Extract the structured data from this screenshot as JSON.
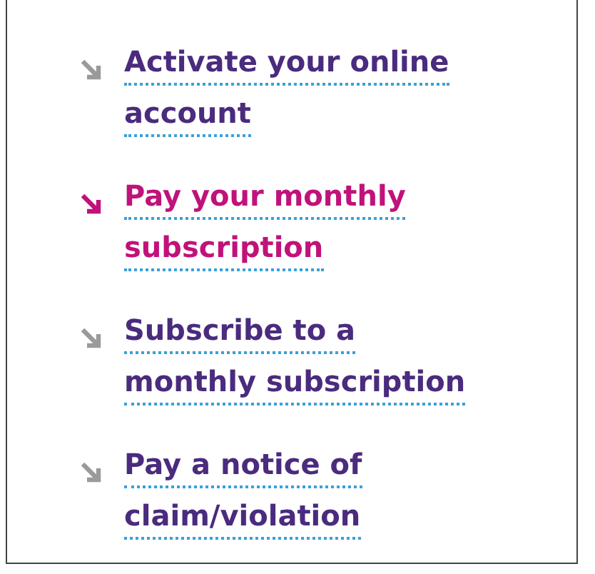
{
  "links": [
    {
      "lines": [
        "Activate your online",
        "account"
      ],
      "selected": false
    },
    {
      "lines": [
        "Pay your monthly",
        "subscription"
      ],
      "selected": true
    },
    {
      "lines": [
        "Subscribe to a",
        "monthly subscription"
      ],
      "selected": false
    },
    {
      "lines": [
        "Pay a notice of",
        "claim/violation"
      ],
      "selected": false
    }
  ]
}
